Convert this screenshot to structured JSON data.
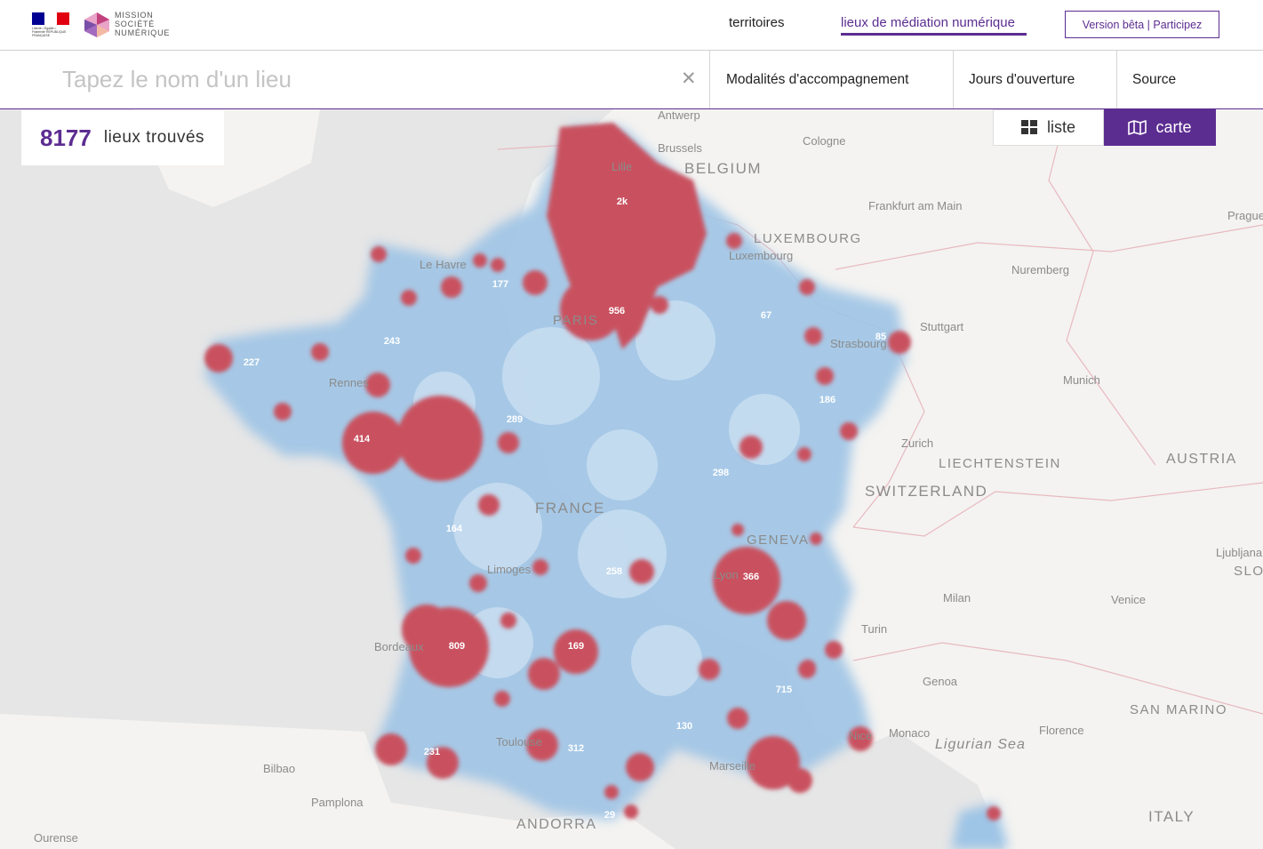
{
  "header": {
    "rf_logo_text": "Liberté • Égalité • Fraternité RÉPUBLIQUE FRANÇAISE",
    "msn_line1": "MISSION",
    "msn_line2": "SOCIÉTÉ",
    "msn_line3": "NUMÉRIQUE",
    "nav": [
      {
        "label": "territoires",
        "active": false
      },
      {
        "label": "lieux de médiation numérique",
        "active": true
      }
    ],
    "beta_label": "Version bêta | Participez"
  },
  "filters": {
    "search_placeholder": "Tapez le nom d'un lieu",
    "search_value": "",
    "clear_icon": "close-icon",
    "items": [
      "Modalités d'accompagnement",
      "Jours d'ouverture",
      "Source"
    ]
  },
  "results": {
    "count": "8177",
    "label": "lieux trouvés"
  },
  "view_toggle": {
    "list_label": "liste",
    "map_label": "carte",
    "active": "carte"
  },
  "colors": {
    "accent": "#5c2d91",
    "heat_low": "#7fb1dc",
    "heat_high": "#c9515f"
  },
  "map": {
    "place_labels": [
      "Antwerp",
      "Brussels",
      "Cologne",
      "BELGIUM",
      "Lille",
      "Frankfurt am Main",
      "Prague",
      "LUXEMBOURG",
      "Luxembourg",
      "Le Havre",
      "Nuremberg",
      "PARIS",
      "Stuttgart",
      "Strasbourg",
      "Munich",
      "Rennes",
      "Zurich",
      "LIECHTENSTEIN",
      "AUSTRIA",
      "SWITZERLAND",
      "FRANCE",
      "GENEVA",
      "Ljubljana",
      "SLO",
      "Limoges",
      "Lyon",
      "Milan",
      "Venice",
      "Turin",
      "Bordeaux",
      "Genoa",
      "SAN MARINO",
      "Florence",
      "Nice",
      "Monaco",
      "Ligurian Sea",
      "Toulouse",
      "Marseille",
      "Bilbao",
      "Pamplona",
      "ANDORRA",
      "ITALY",
      "Ourense"
    ],
    "clusters": [
      "2k",
      "956",
      "177",
      "67",
      "243",
      "227",
      "85",
      "289",
      "186",
      "414",
      "298",
      "164",
      "258",
      "366",
      "809",
      "169",
      "715",
      "130",
      "312",
      "231",
      "29"
    ]
  }
}
